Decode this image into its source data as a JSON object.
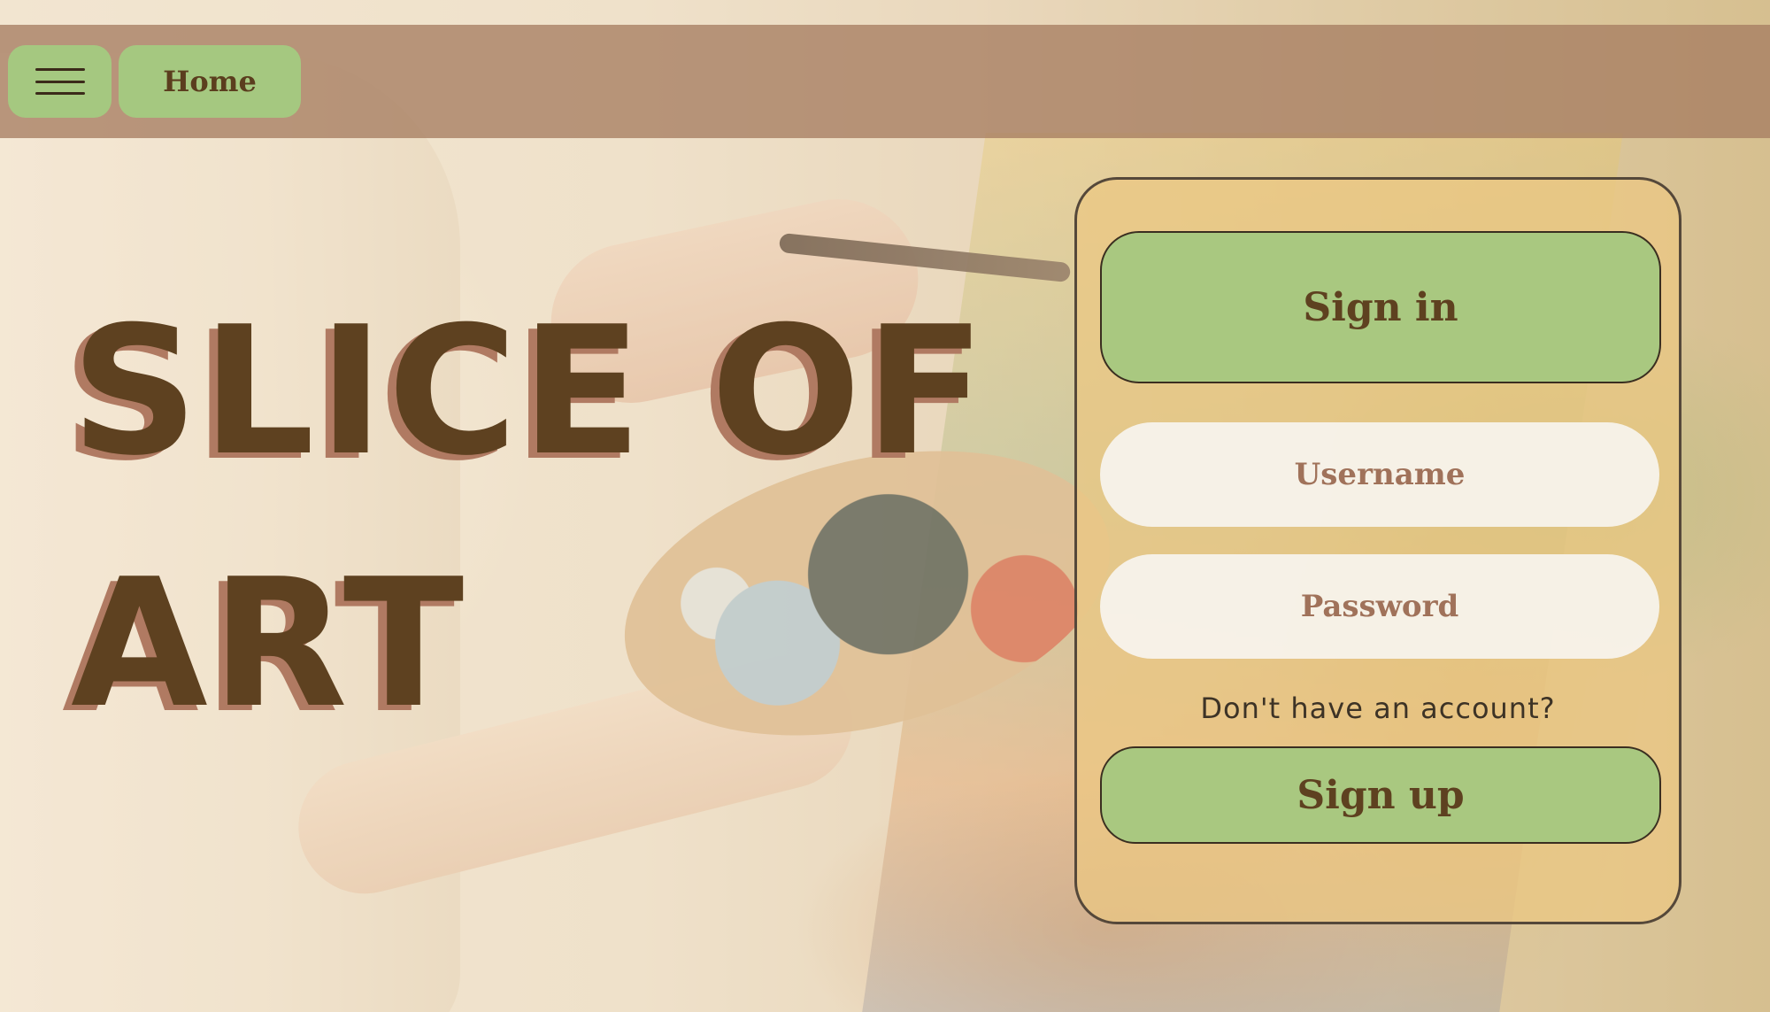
{
  "nav": {
    "menu_icon": "hamburger-menu-icon",
    "home_label": "Home"
  },
  "hero": {
    "title_line_1": "SLICE OF",
    "title_line_2": "ART"
  },
  "login": {
    "signin_label": "Sign in",
    "username_placeholder": "Username",
    "password_placeholder": "Password",
    "signup_prompt": "Don't have an account?",
    "signup_label": "Sign up"
  },
  "colors": {
    "accent_green": "#a5c880",
    "brand_brown": "#5e4120",
    "topbar": "#a77d62",
    "panel": "#ecc882",
    "placeholder_text": "#a0725a"
  }
}
